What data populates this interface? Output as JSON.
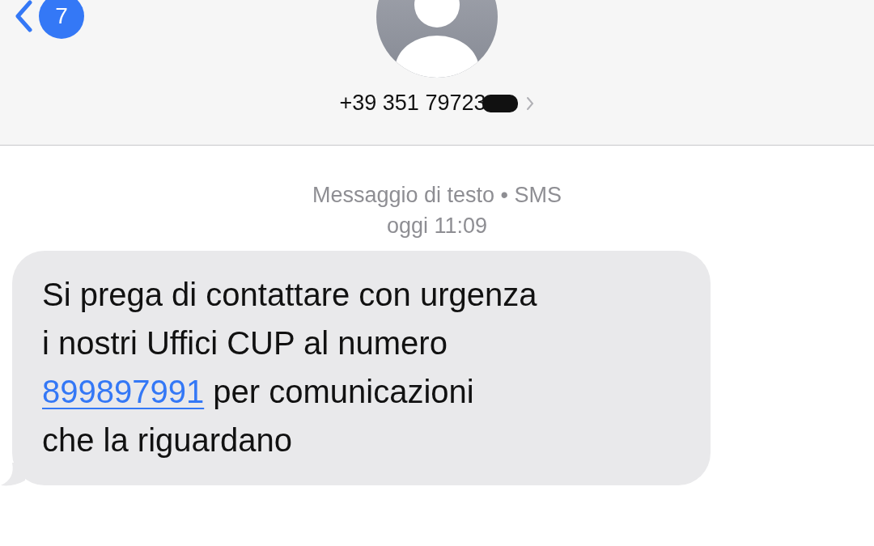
{
  "header": {
    "back_badge": "7",
    "contact": "+39 351 79723",
    "contact_redacted": true
  },
  "meta": {
    "service": "Messaggio di testo • SMS",
    "time": "oggi 11:09"
  },
  "message": {
    "lines": [
      [
        {
          "kind": "text",
          "text": "Si prega di contattare con urgenza"
        }
      ],
      [
        {
          "kind": "text",
          "text": "i nostri Uffici CUP al numero"
        }
      ],
      [
        {
          "kind": "link",
          "text": "899897991"
        },
        {
          "kind": "text",
          "text": " per comunicazioni"
        }
      ],
      [
        {
          "kind": "text",
          "text": "che la riguardano"
        }
      ]
    ]
  }
}
